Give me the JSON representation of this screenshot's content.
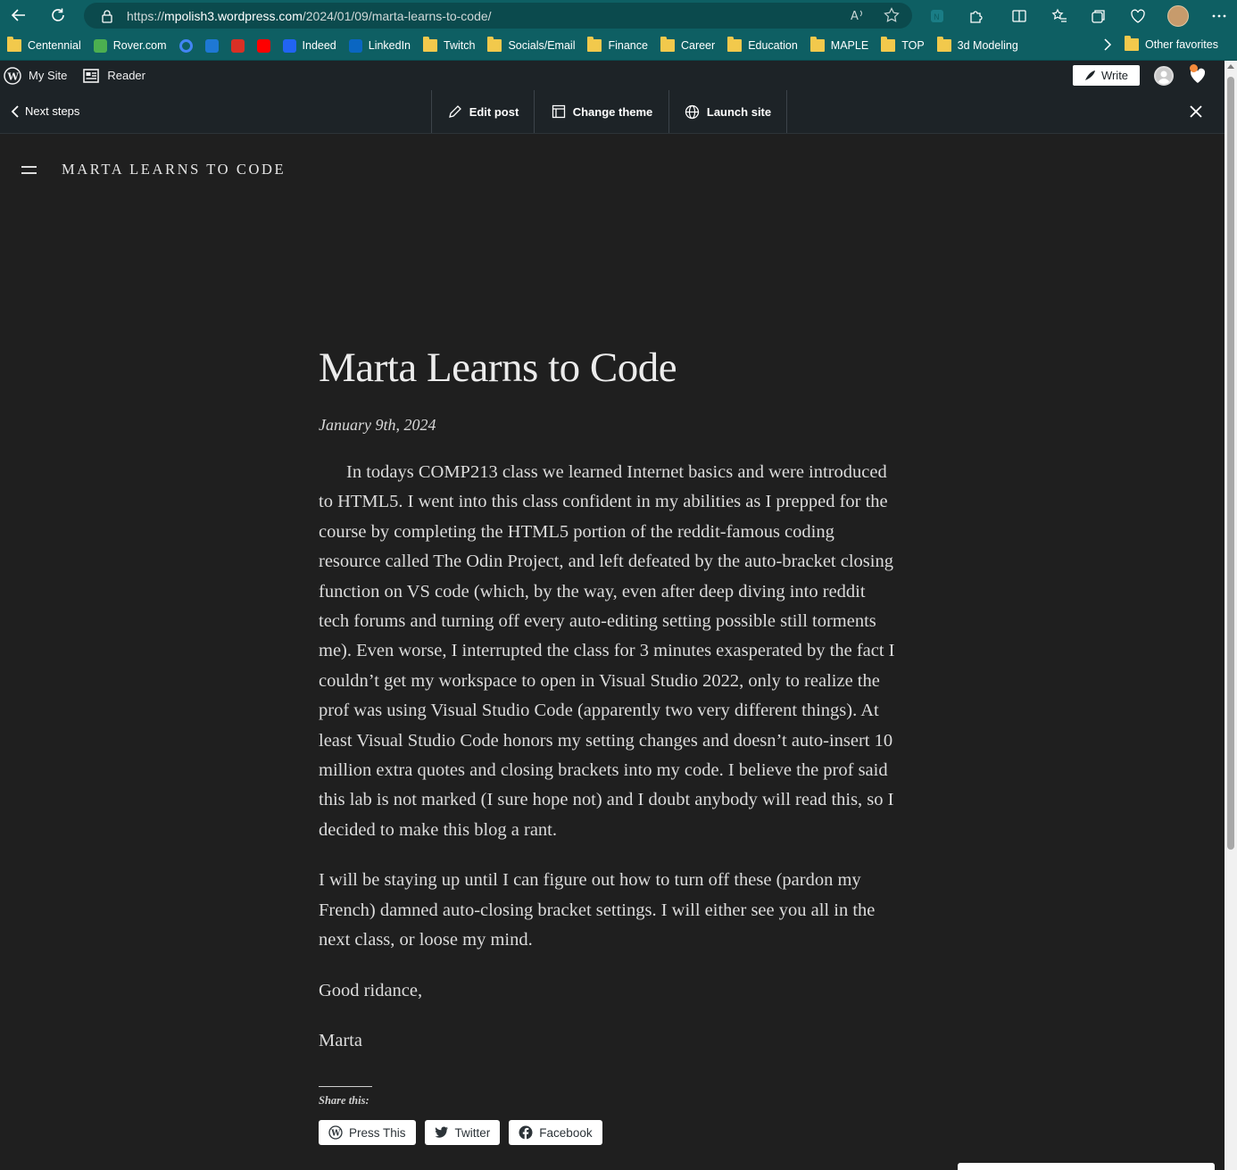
{
  "browser": {
    "url_prefix": "https://",
    "url_host": "mpolish3.wordpress.com",
    "url_path": "/2024/01/09/marta-learns-to-code/",
    "accent_color": "#0e5f63",
    "bookmarks": [
      {
        "label": "Centennial",
        "icon": "folder-icon"
      },
      {
        "label": "Rover.com",
        "icon": "paw-icon"
      },
      {
        "label": "",
        "icon": "google-icon"
      },
      {
        "label": "",
        "icon": "outlook-icon"
      },
      {
        "label": "",
        "icon": "gmail-icon"
      },
      {
        "label": "",
        "icon": "youtube-icon"
      },
      {
        "label": "Indeed",
        "icon": "indeed-icon"
      },
      {
        "label": "LinkedIn",
        "icon": "linkedin-icon"
      },
      {
        "label": "Twitch",
        "icon": "folder-icon"
      },
      {
        "label": "Socials/Email",
        "icon": "folder-icon"
      },
      {
        "label": "Finance",
        "icon": "folder-icon"
      },
      {
        "label": "Career",
        "icon": "folder-icon"
      },
      {
        "label": "Education",
        "icon": "folder-icon"
      },
      {
        "label": "MAPLE",
        "icon": "folder-icon"
      },
      {
        "label": "TOP",
        "icon": "folder-icon"
      },
      {
        "label": "3d Modeling",
        "icon": "folder-icon"
      }
    ],
    "other_favorites": "Other favorites"
  },
  "adminbar": {
    "my_site": "My Site",
    "reader": "Reader",
    "write": "Write"
  },
  "stepbar": {
    "next_steps": "Next steps",
    "edit_post": "Edit post",
    "change_theme": "Change theme",
    "launch_site": "Launch site"
  },
  "site": {
    "title": "MARTA LEARNS TO CODE"
  },
  "post": {
    "title": "Marta Learns to Code",
    "date": "January 9th, 2024",
    "paragraphs": [
      "In todays COMP213 class we learned Internet basics and were introduced to HTML5. I went into this class confident in my abilities as I prepped for the course by completing the HTML5 portion of the reddit-famous coding resource called The Odin Project, and left defeated by the auto-bracket closing function on VS code (which, by the way, even after deep diving into reddit tech forums and turning off every auto-editing setting possible still torments me). Even worse, I interrupted the class for 3 minutes exasperated by the fact I couldn’t get my workspace to open in Visual Studio 2022, only to realize the prof was using Visual Studio Code (apparently two very different things). At least Visual Studio Code honors my setting changes and doesn’t auto-insert 10 million extra quotes and closing brackets into my code. I believe the prof said this lab is not marked (I sure hope not) and I doubt anybody will read this, so I decided to make this blog a rant.",
      "I will be staying up until I can figure out how to turn off these (pardon my French) damned auto-closing bracket settings. I will either see you all in the next class, or loose my mind.",
      "Good ridance,",
      "Marta"
    ],
    "share_title": "Share this:",
    "share_buttons": [
      "Press This",
      "Twitter",
      "Facebook"
    ]
  }
}
